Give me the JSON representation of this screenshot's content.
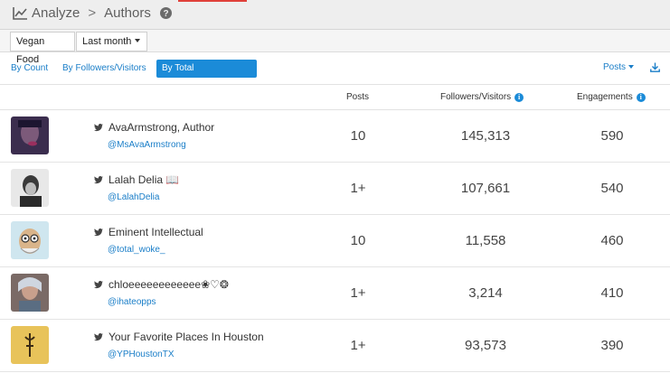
{
  "breadcrumb": {
    "section": "Analyze",
    "page": "Authors",
    "separator": ">",
    "help_glyph": "?"
  },
  "filters": {
    "topic": "Vegan Food",
    "period": "Last month"
  },
  "tabs": [
    {
      "label": "By Count",
      "active": false
    },
    {
      "label": "By Followers/Visitors",
      "active": false
    },
    {
      "label": "By Total Engagements",
      "active": true
    }
  ],
  "sort": {
    "label": "Posts"
  },
  "columns": {
    "posts": "Posts",
    "followers": "Followers/Visitors",
    "engagements": "Engagements"
  },
  "authors": [
    {
      "name": "AvaArmstrong, Author",
      "handle": "@MsAvaArmstrong",
      "posts": "10",
      "followers": "145,313",
      "engagements": "590",
      "avatar_color": "#3b2d4e"
    },
    {
      "name": "Lalah Delia 📖",
      "handle": "@LalahDelia",
      "posts": "1+",
      "followers": "107,661",
      "engagements": "540",
      "avatar_color": "#2a2a2a"
    },
    {
      "name": "Eminent Intellectual",
      "handle": "@total_woke_",
      "posts": "10",
      "followers": "11,558",
      "engagements": "460",
      "avatar_color": "#cfe6ef"
    },
    {
      "name": "chloeeeeeeeeeeee❀♡❂",
      "handle": "@ihateopps",
      "posts": "1+",
      "followers": "3,214",
      "engagements": "410",
      "avatar_color": "#7a6a66"
    },
    {
      "name": "Your Favorite Places In Houston",
      "handle": "@YPHoustonTX",
      "posts": "1+",
      "followers": "93,573",
      "engagements": "390",
      "avatar_color": "#e8c35a"
    }
  ],
  "colors": {
    "accent": "#1b8bd8",
    "link": "#1a7ec8",
    "topbar_red": "#e0403a"
  }
}
